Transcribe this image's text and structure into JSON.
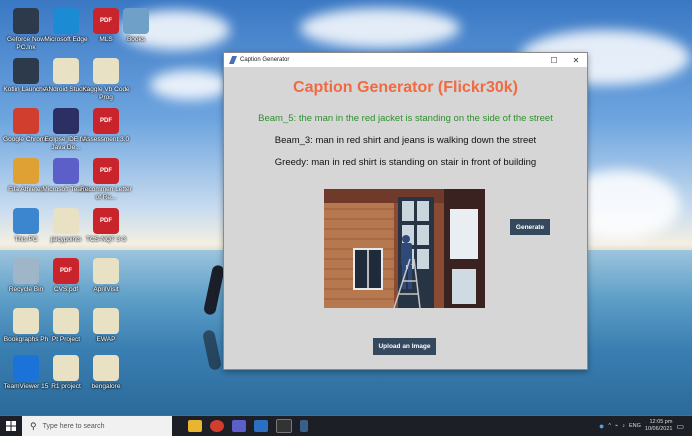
{
  "desktop": {
    "icons": [
      {
        "label": "Geforce Now PC.lnk",
        "icon": "nvidia-icon",
        "color": "#2d3a4c"
      },
      {
        "label": "Microsoft Edge",
        "icon": "edge-icon",
        "color": "#1b8bd3"
      },
      {
        "label": "MLS",
        "icon": "pdf-icon",
        "color": "#c9242b"
      },
      {
        "label": "Books",
        "icon": "folder-icon",
        "color": "#6fa0c8"
      },
      {
        "label": "Kotlin Launcher",
        "icon": "check-icon",
        "color": "#2d3a4c"
      },
      {
        "label": "ANdroid Studio",
        "icon": "doc-icon",
        "color": "#e8e1c4"
      },
      {
        "label": "Kaggle Vb Code Prog",
        "icon": "doc-icon",
        "color": "#e8e1c4"
      },
      {
        "label": "Google Chrome",
        "icon": "chrome-icon",
        "color": "#d23e2e"
      },
      {
        "label": "Eclipse IDE for Java De...",
        "icon": "eclipse-icon",
        "color": "#2b2f63"
      },
      {
        "label": "Assessment 3.0",
        "icon": "pdf-icon",
        "color": "#c9242b"
      },
      {
        "label": "Fifa Athletes",
        "icon": "user-icon",
        "color": "#e0a134"
      },
      {
        "label": "Microsoft Teams",
        "icon": "teams-icon",
        "color": "#5b5fc7"
      },
      {
        "label": "Recommen Letter of Re...",
        "icon": "pdf-icon",
        "color": "#c9242b"
      },
      {
        "label": "This PC",
        "icon": "pc-icon",
        "color": "#3c86d0"
      },
      {
        "label": "jaicypoints",
        "icon": "doc-icon",
        "color": "#e8e1c4"
      },
      {
        "label": "TCS-NQT 3-3",
        "icon": "pdf-icon",
        "color": "#c9242b"
      },
      {
        "label": "Recycle Bin",
        "icon": "recycle-icon",
        "color": "#9fb6c9"
      },
      {
        "label": "CVS.pdf",
        "icon": "pdf-icon",
        "color": "#c9242b"
      },
      {
        "label": "AprilVisit",
        "icon": "doc-icon",
        "color": "#e8e1c4"
      },
      {
        "label": "Bookgraphs Ph",
        "icon": "doc-icon",
        "color": "#e8e1c4"
      },
      {
        "label": "Pt Project",
        "icon": "doc-icon",
        "color": "#e8e1c4"
      },
      {
        "label": "EWAP",
        "icon": "doc-icon",
        "color": "#e8e1c4"
      },
      {
        "label": "TeamViewer 15",
        "icon": "teamviewer-icon",
        "color": "#1b72d9"
      },
      {
        "label": "R1 project",
        "icon": "doc-icon",
        "color": "#e8e1c4"
      },
      {
        "label": "bengalore",
        "icon": "doc-icon",
        "color": "#e8e1c4"
      }
    ]
  },
  "window": {
    "title": "Caption Generator",
    "app_title": "Caption Generator (Flickr30k)",
    "beam5": "Beam_5: the man in the red jacket is standing on the side of the street",
    "beam3": "Beam_3: man in red shirt and jeans is walking down the street",
    "greedy": "Greedy: man in red shirt is standing on stair in front of building",
    "generate_label": "Generate",
    "upload_label": "Upload an Image",
    "colors": {
      "title": "#f06a42",
      "beam5": "#2f8f2f",
      "button": "#34495e"
    }
  },
  "taskbar": {
    "search_placeholder": "Type here to search",
    "time": "12:05 pm",
    "date": "10/06/2021",
    "lang": "ENG"
  }
}
